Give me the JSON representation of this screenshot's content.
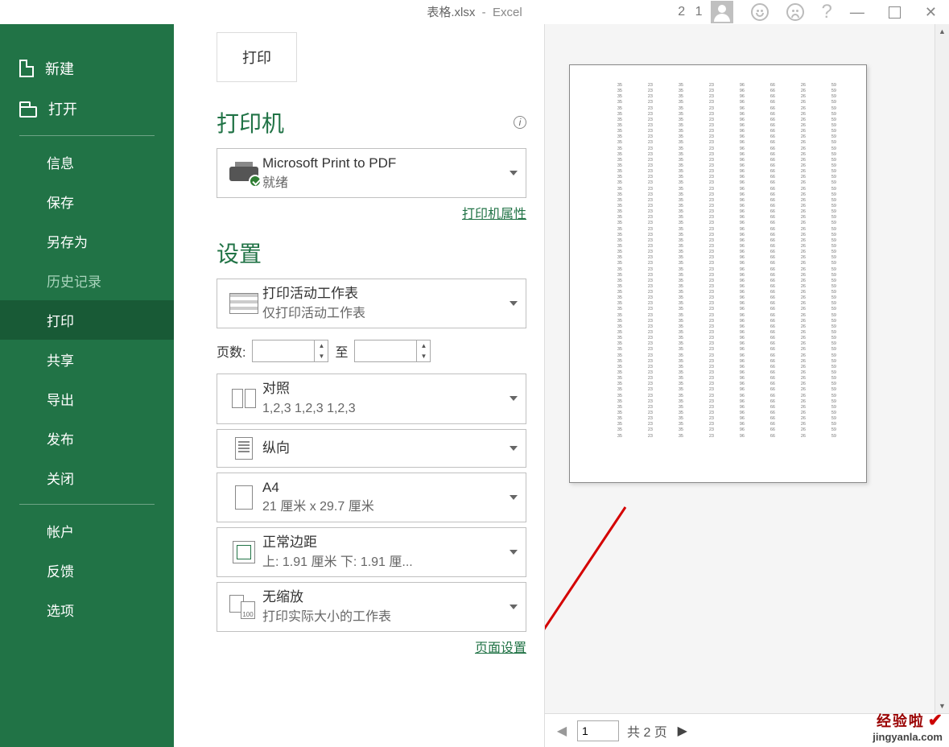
{
  "window": {
    "filename": "表格.xlsx",
    "app": "Excel",
    "user_label": "2 1"
  },
  "sidebar": {
    "new": "新建",
    "open": "打开",
    "info": "信息",
    "save": "保存",
    "saveas": "另存为",
    "history": "历史记录",
    "print": "打印",
    "share": "共享",
    "export": "导出",
    "publish": "发布",
    "close": "关闭",
    "account": "帐户",
    "feedback": "反馈",
    "options": "选项"
  },
  "print": {
    "button": "打印",
    "printer_heading": "打印机",
    "printer_name": "Microsoft Print to PDF",
    "printer_status": "就绪",
    "printer_props": "打印机属性",
    "settings_heading": "设置",
    "setting_active_sheet": {
      "title": "打印活动工作表",
      "sub": "仅打印活动工作表"
    },
    "pages_label": "页数:",
    "pages_to": "至",
    "pages_from": "",
    "pages_to_val": "",
    "collate": {
      "title": "对照",
      "sub": "1,2,3    1,2,3    1,2,3"
    },
    "orientation": {
      "title": "纵向"
    },
    "paper": {
      "title": "A4",
      "sub": "21 厘米 x 29.7 厘米"
    },
    "margins": {
      "title": "正常边距",
      "sub": "上: 1.91 厘米 下: 1.91 厘..."
    },
    "scaling": {
      "title": "无缩放",
      "sub": "打印实际大小的工作表",
      "num": "100"
    },
    "page_setup": "页面设置"
  },
  "nav": {
    "current": "1",
    "of_label": "共 2 页"
  },
  "watermark": {
    "cn": "经验啦",
    "url": "jingyanla.com"
  },
  "chart_data": {
    "type": "table",
    "description": "Print preview page showing a simple numeric spreadsheet",
    "rows": 62,
    "cols": 8,
    "column_values": [
      35,
      23,
      35,
      23,
      96,
      66,
      26,
      59
    ],
    "note": "Each row approximately repeats the same values per column as visible in the preview."
  }
}
